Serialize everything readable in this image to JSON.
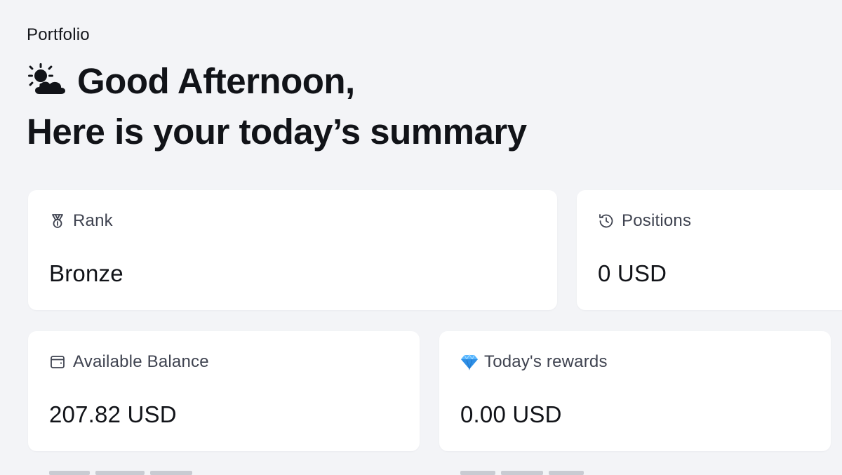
{
  "header": {
    "breadcrumb": "Portfolio",
    "greeting": "Good Afternoon,",
    "greeting_icon": "sun-behind-cloud-icon",
    "subtitle": "Here is your today’s summary"
  },
  "cards": {
    "rank": {
      "label": "Rank",
      "value": "Bronze",
      "icon": "medal-icon"
    },
    "positions": {
      "label": "Positions",
      "value": "0 USD",
      "icon": "history-clock-icon"
    },
    "available_balance": {
      "label": "Available Balance",
      "value": "207.82 USD",
      "icon": "wallet-icon"
    },
    "todays_rewards": {
      "label": "Today's rewards",
      "value": "0.00 USD",
      "icon": "diamond-icon"
    }
  },
  "colors": {
    "background": "#f3f4f7",
    "card": "#ffffff",
    "text_primary": "#111318",
    "text_secondary": "#3f4350",
    "diamond": "#3b9cf0"
  }
}
